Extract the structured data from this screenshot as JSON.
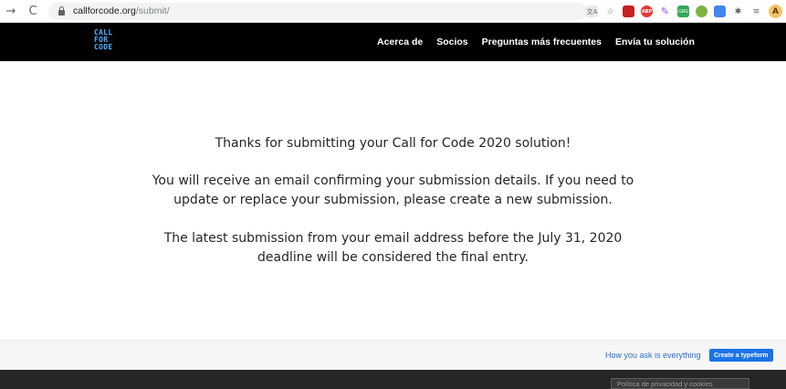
{
  "browser": {
    "back_icon": "→",
    "reload_icon": "C",
    "url_host": "callforcode.org",
    "url_path": "/submit/",
    "extensions": [
      "translate-icon",
      "star-icon",
      "pdf-extension-icon",
      "adblock-icon",
      "pen-extension-icon",
      "green-extension-icon",
      "leaf-extension-icon",
      "blue-extension-icon",
      "puzzle-icon",
      "playlist-icon",
      "profile-avatar"
    ],
    "avatar_letter": "A",
    "abp_label": "ABP",
    "green_label": "GRG"
  },
  "site": {
    "logo_lines": [
      "CALL",
      "FOR",
      "CODE"
    ],
    "nav": [
      {
        "label": "Acerca de"
      },
      {
        "label": "Socios"
      },
      {
        "label": "Preguntas más frecuentes"
      },
      {
        "label": "Envía tu solución"
      }
    ]
  },
  "main": {
    "thanks": "Thanks for submitting your Call for Code 2020 solution!",
    "email_line_1": "You will receive an email confirming your submission details. If you need to",
    "email_line_2": "update or replace your submission, please create a new submission.",
    "deadline_line_1": "The latest submission from your email address before the July 31, 2020",
    "deadline_line_2": "deadline will be considered the final entry."
  },
  "typeform": {
    "link_text": "How you ask is everything",
    "button_label": "Create a typeform"
  },
  "privacy": {
    "label": "Política de privacidad y cookies"
  },
  "colors": {
    "header_bg": "#000000",
    "logo": "#4eb4ff",
    "typeform_button": "#1a73e8"
  }
}
